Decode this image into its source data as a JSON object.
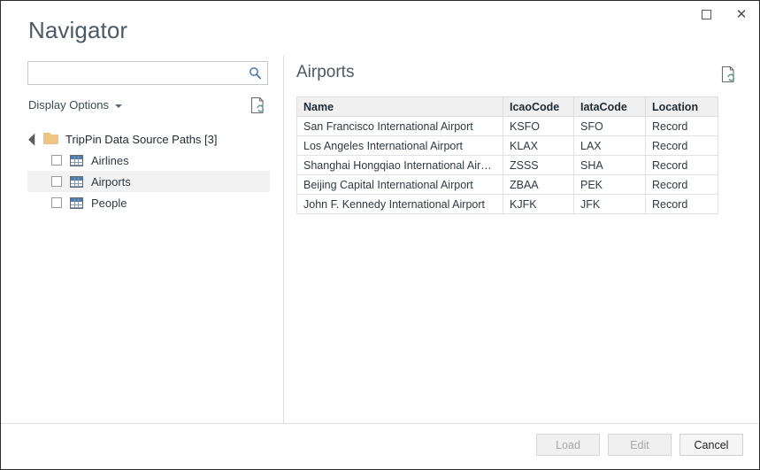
{
  "window": {
    "title": "Navigator",
    "controls": [
      {
        "name": "maximize-button",
        "icon": "maximize-icon"
      },
      {
        "name": "close-button",
        "icon": "close-icon"
      }
    ]
  },
  "search": {
    "value": "",
    "placeholder": "",
    "icon": "search-icon"
  },
  "display_options": {
    "label": "Display Options",
    "caret_icon": "chevron-down-icon"
  },
  "left_refresh": {
    "icon": "refresh-preview-icon",
    "tooltip": ""
  },
  "tree": {
    "root": {
      "label": "TripPin Data Source Paths [3]",
      "expanded": true,
      "icon": "folder-icon"
    },
    "items": [
      {
        "label": "Airlines",
        "checked": false,
        "selected": false,
        "icon": "table-icon"
      },
      {
        "label": "Airports",
        "checked": false,
        "selected": true,
        "icon": "table-icon"
      },
      {
        "label": "People",
        "checked": false,
        "selected": false,
        "icon": "table-icon"
      }
    ]
  },
  "preview": {
    "title": "Airports",
    "refresh_icon": "refresh-preview-icon",
    "columns": [
      "Name",
      "IcaoCode",
      "IataCode",
      "Location"
    ],
    "rows": [
      [
        "San Francisco International Airport",
        "KSFO",
        "SFO",
        "Record"
      ],
      [
        "Los Angeles International Airport",
        "KLAX",
        "LAX",
        "Record"
      ],
      [
        "Shanghai Hongqiao International Airport",
        "ZSSS",
        "SHA",
        "Record"
      ],
      [
        "Beijing Capital International Airport",
        "ZBAA",
        "PEK",
        "Record"
      ],
      [
        "John F. Kennedy International Airport",
        "KJFK",
        "JFK",
        "Record"
      ]
    ]
  },
  "footer": {
    "buttons": [
      {
        "label": "Load",
        "enabled": false
      },
      {
        "label": "Edit",
        "enabled": false
      },
      {
        "label": "Cancel",
        "enabled": true
      }
    ]
  },
  "colors": {
    "title_text": "#4b5a66",
    "accent_blue": "#4a7ebb",
    "folder": "#eec584",
    "refresh_green": "#5a9e8e",
    "selection": "#f2f2f2",
    "header_row": "#f0f0f0",
    "border": "#e2e2e2"
  }
}
